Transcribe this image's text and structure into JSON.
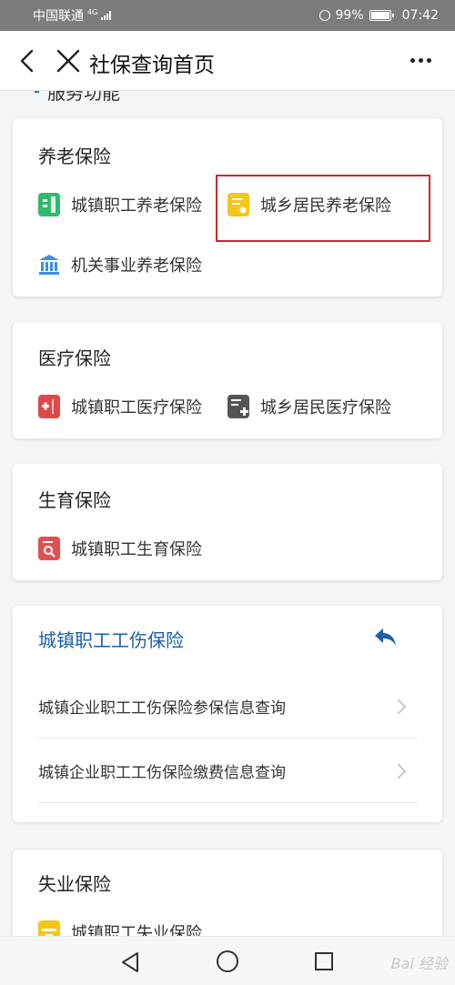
{
  "status_bar": {
    "carrier": "中国联通",
    "network": "4G",
    "battery": "99%",
    "time": "07:42"
  },
  "header": {
    "title": "社保查询首页"
  },
  "peek_section_title": "服务功能",
  "pension": {
    "title": "养老保险",
    "items": [
      {
        "label": "城镇职工养老保险",
        "icon": "building-icon",
        "color": "#2dbb6b"
      },
      {
        "label": "城乡居民养老保险",
        "icon": "document-icon",
        "color": "#f5c518"
      },
      {
        "label": "机关事业养老保险",
        "icon": "bank-icon",
        "color": "#3d8fe0"
      }
    ]
  },
  "medical": {
    "title": "医疗保险",
    "items": [
      {
        "label": "城镇职工医疗保险",
        "icon": "medical-kit-icon",
        "color": "#e04848"
      },
      {
        "label": "城乡居民医疗保险",
        "icon": "medical-document-icon",
        "color": "#555555"
      }
    ]
  },
  "maternity": {
    "title": "生育保险",
    "items": [
      {
        "label": "城镇职工生育保险",
        "icon": "search-document-icon",
        "color": "#e05050"
      }
    ]
  },
  "injury": {
    "title": "城镇职工工伤保险",
    "rows": [
      {
        "label": "城镇企业职工工伤保险参保信息查询"
      },
      {
        "label": "城镇企业职工工伤保险缴费信息查询"
      }
    ]
  },
  "unemployment": {
    "title": "失业保险",
    "items": [
      {
        "label": "城镇职工失业保险",
        "icon": "wallet-icon",
        "color": "#f5c518"
      }
    ]
  },
  "watermark": "Bai 经验",
  "colors": {
    "accent_blue": "#1a5fa8",
    "highlight_red": "#c8282e"
  }
}
